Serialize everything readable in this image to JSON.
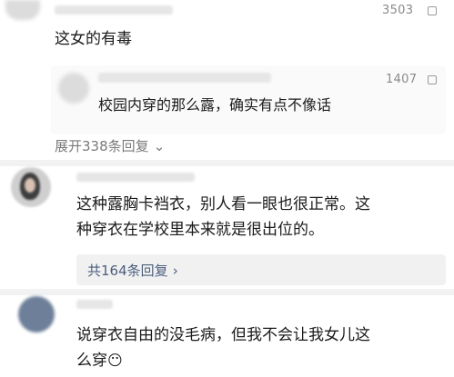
{
  "comments": [
    {
      "likes": "3503",
      "text": "这女的有毒",
      "reply": {
        "likes": "1407",
        "text": "校园内穿的那么露，确实有点不像话"
      },
      "expand_label": "展开338条回复"
    },
    {
      "text_line1": "这种露胸卡裆衣，别人看一眼也很正常。这",
      "text_line2": "种穿衣在学校里本来就是很出位的。",
      "expand_label": "共164条回复"
    },
    {
      "text_line1": "说穿衣自由的没毛病，但我不会让我女儿这",
      "text_line2": "么穿",
      "emoji": "😶"
    }
  ]
}
